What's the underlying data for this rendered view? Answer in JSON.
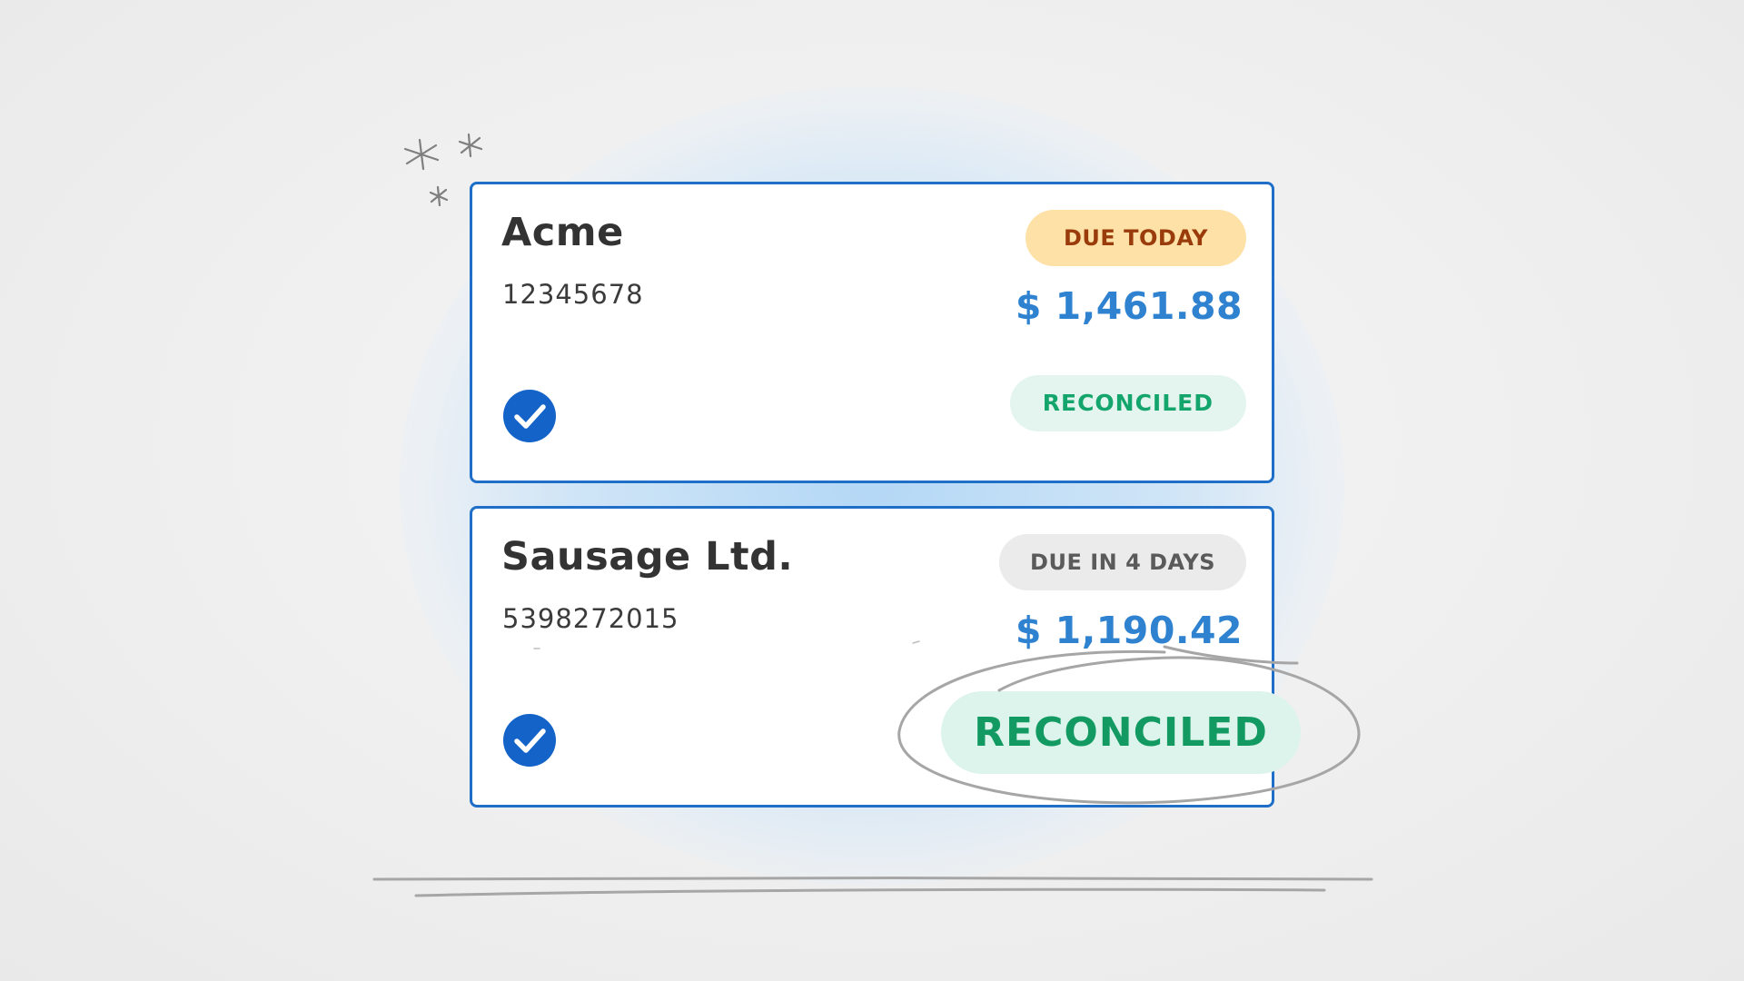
{
  "invoices": [
    {
      "company": "Acme",
      "account_number": "12345678",
      "due_status": "DUE TODAY",
      "amount": "$ 1,461.88",
      "status": "RECONCILED",
      "selected": true
    },
    {
      "company": "Sausage Ltd.",
      "account_number": "5398272015",
      "due_status": "DUE IN 4 DAYS",
      "amount": "$ 1,190.42",
      "status": "RECONCILED",
      "selected": true
    }
  ],
  "highlight": {
    "label": "RECONCILED"
  },
  "colors": {
    "card_border": "#1f6fc9",
    "amount": "#2e82d0",
    "due_today_bg": "#fde1a6",
    "due_today_text": "#9a3b0c",
    "due_later_bg": "#ebebeb",
    "due_later_text": "#5a5a5a",
    "reconciled_bg": "#e3f5ee",
    "reconciled_text": "#13a56c",
    "check_fill": "#1463c8"
  },
  "icons": {
    "selected": "checkmark-circle-icon",
    "decoration": "sparkle-icon"
  }
}
